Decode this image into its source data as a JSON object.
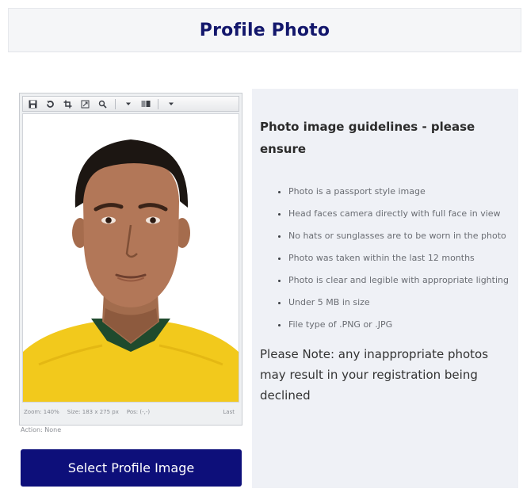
{
  "header": {
    "title": "Profile Photo"
  },
  "editor": {
    "toolbar": {
      "icons": [
        "save-icon",
        "reset-icon",
        "crop-icon",
        "resize-icon",
        "zoom-icon",
        "dropdown-arrow-icon",
        "view-mode-icon",
        "dropdown-arrow-icon"
      ]
    },
    "status": {
      "zoom": "Zoom: 140%",
      "size": "Size: 183 x 275 px",
      "pos": "Pos: (-,-)",
      "last": "Last"
    },
    "action": "Action: None"
  },
  "select_button": {
    "label": "Select Profile Image"
  },
  "guidelines": {
    "heading": "Photo image guidelines - please ensure",
    "items": [
      "Photo is a passport style image",
      "Head faces camera directly with full face in view",
      "No hats or sunglasses are to be worn in the photo",
      "Photo was taken within the last 12 months",
      "Photo is clear and legible with appropriate lighting",
      "Under 5 MB in size",
      "File type of .PNG or .JPG"
    ],
    "note": "Please Note: any inappropriate photos may result in your registration being declined"
  },
  "colors": {
    "header_title": "#13176c",
    "button_bg": "#0d0f7a",
    "panel_bg": "#eff1f6",
    "jersey_yellow": "#f2c91c",
    "jersey_green": "#1f4a2d"
  }
}
